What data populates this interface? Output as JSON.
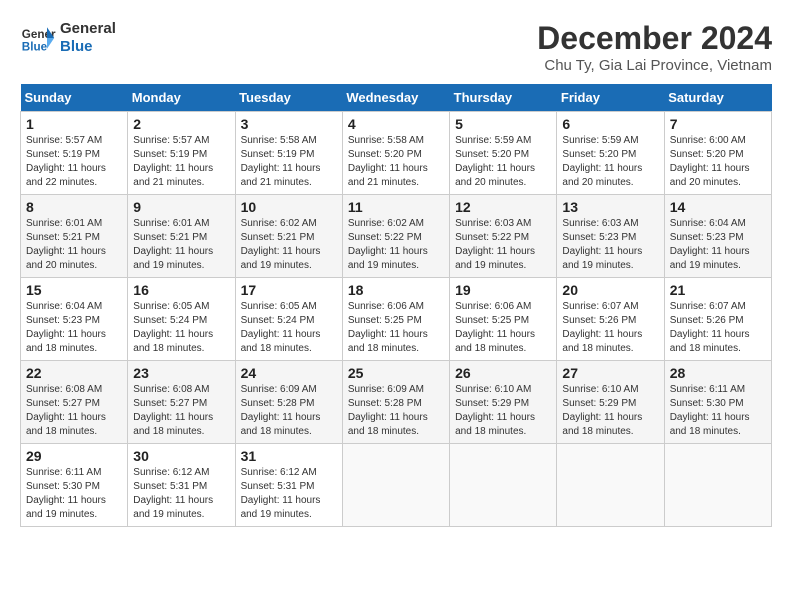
{
  "header": {
    "logo_line1": "General",
    "logo_line2": "Blue",
    "month_title": "December 2024",
    "subtitle": "Chu Ty, Gia Lai Province, Vietnam"
  },
  "weekdays": [
    "Sunday",
    "Monday",
    "Tuesday",
    "Wednesday",
    "Thursday",
    "Friday",
    "Saturday"
  ],
  "weeks": [
    [
      {
        "day": "1",
        "sunrise": "5:57 AM",
        "sunset": "5:19 PM",
        "daylight": "11 hours and 22 minutes."
      },
      {
        "day": "2",
        "sunrise": "5:57 AM",
        "sunset": "5:19 PM",
        "daylight": "11 hours and 21 minutes."
      },
      {
        "day": "3",
        "sunrise": "5:58 AM",
        "sunset": "5:19 PM",
        "daylight": "11 hours and 21 minutes."
      },
      {
        "day": "4",
        "sunrise": "5:58 AM",
        "sunset": "5:20 PM",
        "daylight": "11 hours and 21 minutes."
      },
      {
        "day": "5",
        "sunrise": "5:59 AM",
        "sunset": "5:20 PM",
        "daylight": "11 hours and 20 minutes."
      },
      {
        "day": "6",
        "sunrise": "5:59 AM",
        "sunset": "5:20 PM",
        "daylight": "11 hours and 20 minutes."
      },
      {
        "day": "7",
        "sunrise": "6:00 AM",
        "sunset": "5:20 PM",
        "daylight": "11 hours and 20 minutes."
      }
    ],
    [
      {
        "day": "8",
        "sunrise": "6:01 AM",
        "sunset": "5:21 PM",
        "daylight": "11 hours and 20 minutes."
      },
      {
        "day": "9",
        "sunrise": "6:01 AM",
        "sunset": "5:21 PM",
        "daylight": "11 hours and 19 minutes."
      },
      {
        "day": "10",
        "sunrise": "6:02 AM",
        "sunset": "5:21 PM",
        "daylight": "11 hours and 19 minutes."
      },
      {
        "day": "11",
        "sunrise": "6:02 AM",
        "sunset": "5:22 PM",
        "daylight": "11 hours and 19 minutes."
      },
      {
        "day": "12",
        "sunrise": "6:03 AM",
        "sunset": "5:22 PM",
        "daylight": "11 hours and 19 minutes."
      },
      {
        "day": "13",
        "sunrise": "6:03 AM",
        "sunset": "5:23 PM",
        "daylight": "11 hours and 19 minutes."
      },
      {
        "day": "14",
        "sunrise": "6:04 AM",
        "sunset": "5:23 PM",
        "daylight": "11 hours and 19 minutes."
      }
    ],
    [
      {
        "day": "15",
        "sunrise": "6:04 AM",
        "sunset": "5:23 PM",
        "daylight": "11 hours and 18 minutes."
      },
      {
        "day": "16",
        "sunrise": "6:05 AM",
        "sunset": "5:24 PM",
        "daylight": "11 hours and 18 minutes."
      },
      {
        "day": "17",
        "sunrise": "6:05 AM",
        "sunset": "5:24 PM",
        "daylight": "11 hours and 18 minutes."
      },
      {
        "day": "18",
        "sunrise": "6:06 AM",
        "sunset": "5:25 PM",
        "daylight": "11 hours and 18 minutes."
      },
      {
        "day": "19",
        "sunrise": "6:06 AM",
        "sunset": "5:25 PM",
        "daylight": "11 hours and 18 minutes."
      },
      {
        "day": "20",
        "sunrise": "6:07 AM",
        "sunset": "5:26 PM",
        "daylight": "11 hours and 18 minutes."
      },
      {
        "day": "21",
        "sunrise": "6:07 AM",
        "sunset": "5:26 PM",
        "daylight": "11 hours and 18 minutes."
      }
    ],
    [
      {
        "day": "22",
        "sunrise": "6:08 AM",
        "sunset": "5:27 PM",
        "daylight": "11 hours and 18 minutes."
      },
      {
        "day": "23",
        "sunrise": "6:08 AM",
        "sunset": "5:27 PM",
        "daylight": "11 hours and 18 minutes."
      },
      {
        "day": "24",
        "sunrise": "6:09 AM",
        "sunset": "5:28 PM",
        "daylight": "11 hours and 18 minutes."
      },
      {
        "day": "25",
        "sunrise": "6:09 AM",
        "sunset": "5:28 PM",
        "daylight": "11 hours and 18 minutes."
      },
      {
        "day": "26",
        "sunrise": "6:10 AM",
        "sunset": "5:29 PM",
        "daylight": "11 hours and 18 minutes."
      },
      {
        "day": "27",
        "sunrise": "6:10 AM",
        "sunset": "5:29 PM",
        "daylight": "11 hours and 18 minutes."
      },
      {
        "day": "28",
        "sunrise": "6:11 AM",
        "sunset": "5:30 PM",
        "daylight": "11 hours and 18 minutes."
      }
    ],
    [
      {
        "day": "29",
        "sunrise": "6:11 AM",
        "sunset": "5:30 PM",
        "daylight": "11 hours and 19 minutes."
      },
      {
        "day": "30",
        "sunrise": "6:12 AM",
        "sunset": "5:31 PM",
        "daylight": "11 hours and 19 minutes."
      },
      {
        "day": "31",
        "sunrise": "6:12 AM",
        "sunset": "5:31 PM",
        "daylight": "11 hours and 19 minutes."
      },
      null,
      null,
      null,
      null
    ]
  ],
  "labels": {
    "sunrise": "Sunrise:",
    "sunset": "Sunset:",
    "daylight": "Daylight:"
  }
}
